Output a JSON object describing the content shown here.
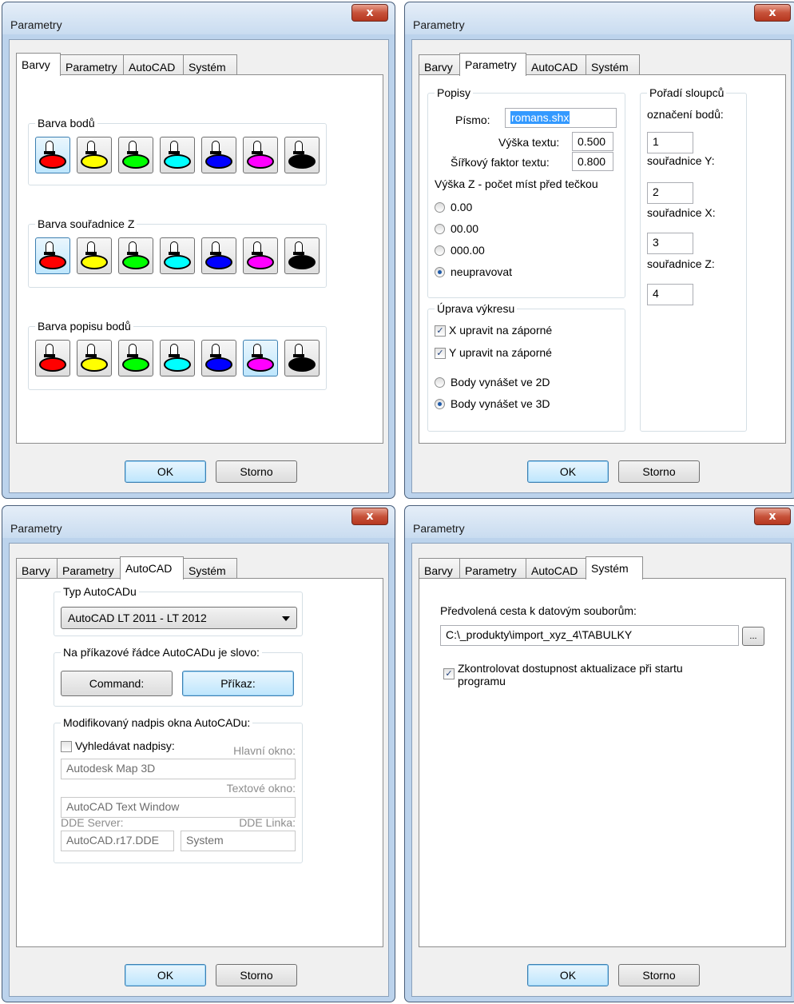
{
  "window_title": "Parametry",
  "close_glyph": "x",
  "tabs": [
    "Barvy",
    "Parametry",
    "AutoCAD",
    "Systém"
  ],
  "buttons": {
    "ok": "OK",
    "cancel": "Storno"
  },
  "colors": {
    "red": "#ff0000",
    "yellow": "#ffff00",
    "green": "#00ff00",
    "cyan": "#00ffff",
    "blue": "#0000ff",
    "magenta": "#ff00ff",
    "black": "#000000"
  },
  "barvy": {
    "groups": [
      {
        "title": "Barva bodů",
        "selected_color": "red"
      },
      {
        "title": "Barva souřadnice Z",
        "selected_color": "red"
      },
      {
        "title": "Barva popisu bodů",
        "selected_color": "magenta"
      }
    ],
    "palette": [
      "red",
      "yellow",
      "green",
      "cyan",
      "blue",
      "magenta",
      "black"
    ]
  },
  "parametry": {
    "popisy_title": "Popisy",
    "pismo_label": "Písmo:",
    "pismo_value": "romans.shx",
    "vyska_label": "Výška textu:",
    "vyska_value": "0.500",
    "sirka_label": "Šířkový faktor textu:",
    "sirka_value": "0.800",
    "vyska_z_label": "Výška Z - počet míst před tečkou",
    "radio_options": [
      "0.00",
      "00.00",
      "000.00",
      "neupravovat"
    ],
    "radio_selected": "neupravovat",
    "uprava_title": "Úprava výkresu",
    "x_neg": "X upravit na záporné",
    "y_neg": "Y upravit na záporné",
    "mode_2d": "Body vynášet ve 2D",
    "mode_3d": "Body vynášet ve 3D",
    "mode_selected": "3D",
    "poradi_title": "Pořadí sloupců",
    "poradi": [
      {
        "label": "označení bodů:",
        "value": "1"
      },
      {
        "label": "souřadnice Y:",
        "value": "2"
      },
      {
        "label": "souřadnice X:",
        "value": "3"
      },
      {
        "label": "souřadnice Z:",
        "value": "4"
      }
    ]
  },
  "autocad": {
    "typ_title": "Typ AutoCADu",
    "typ_value": "AutoCAD LT 2011 - LT 2012",
    "slovo_title": "Na příkazové řádce AutoCADu je slovo:",
    "command": "Command:",
    "prikaz": "Příkaz:",
    "modif_title": "Modifikovaný nadpis okna AutoCADu:",
    "vyhledavat": "Vyhledávat nadpisy:",
    "hlavni_label": "Hlavní okno:",
    "hlavni_value": "Autodesk Map 3D",
    "textove_label": "Textové okno:",
    "textove_value": "AutoCAD Text Window",
    "dde_server_label": "DDE Server:",
    "dde_linka_label": "DDE Linka:",
    "dde_server_value": "AutoCAD.r17.DDE",
    "dde_linka_value": "System"
  },
  "system": {
    "cesta_label": "Předvolená cesta k datovým souborům:",
    "cesta_value": "C:\\_produkty\\import_xyz_4\\TABULKY",
    "browse": "...",
    "zkontrolovat_line1": "Zkontrolovat dostupnost aktualizace při startu",
    "zkontrolovat_line2": "programu"
  }
}
